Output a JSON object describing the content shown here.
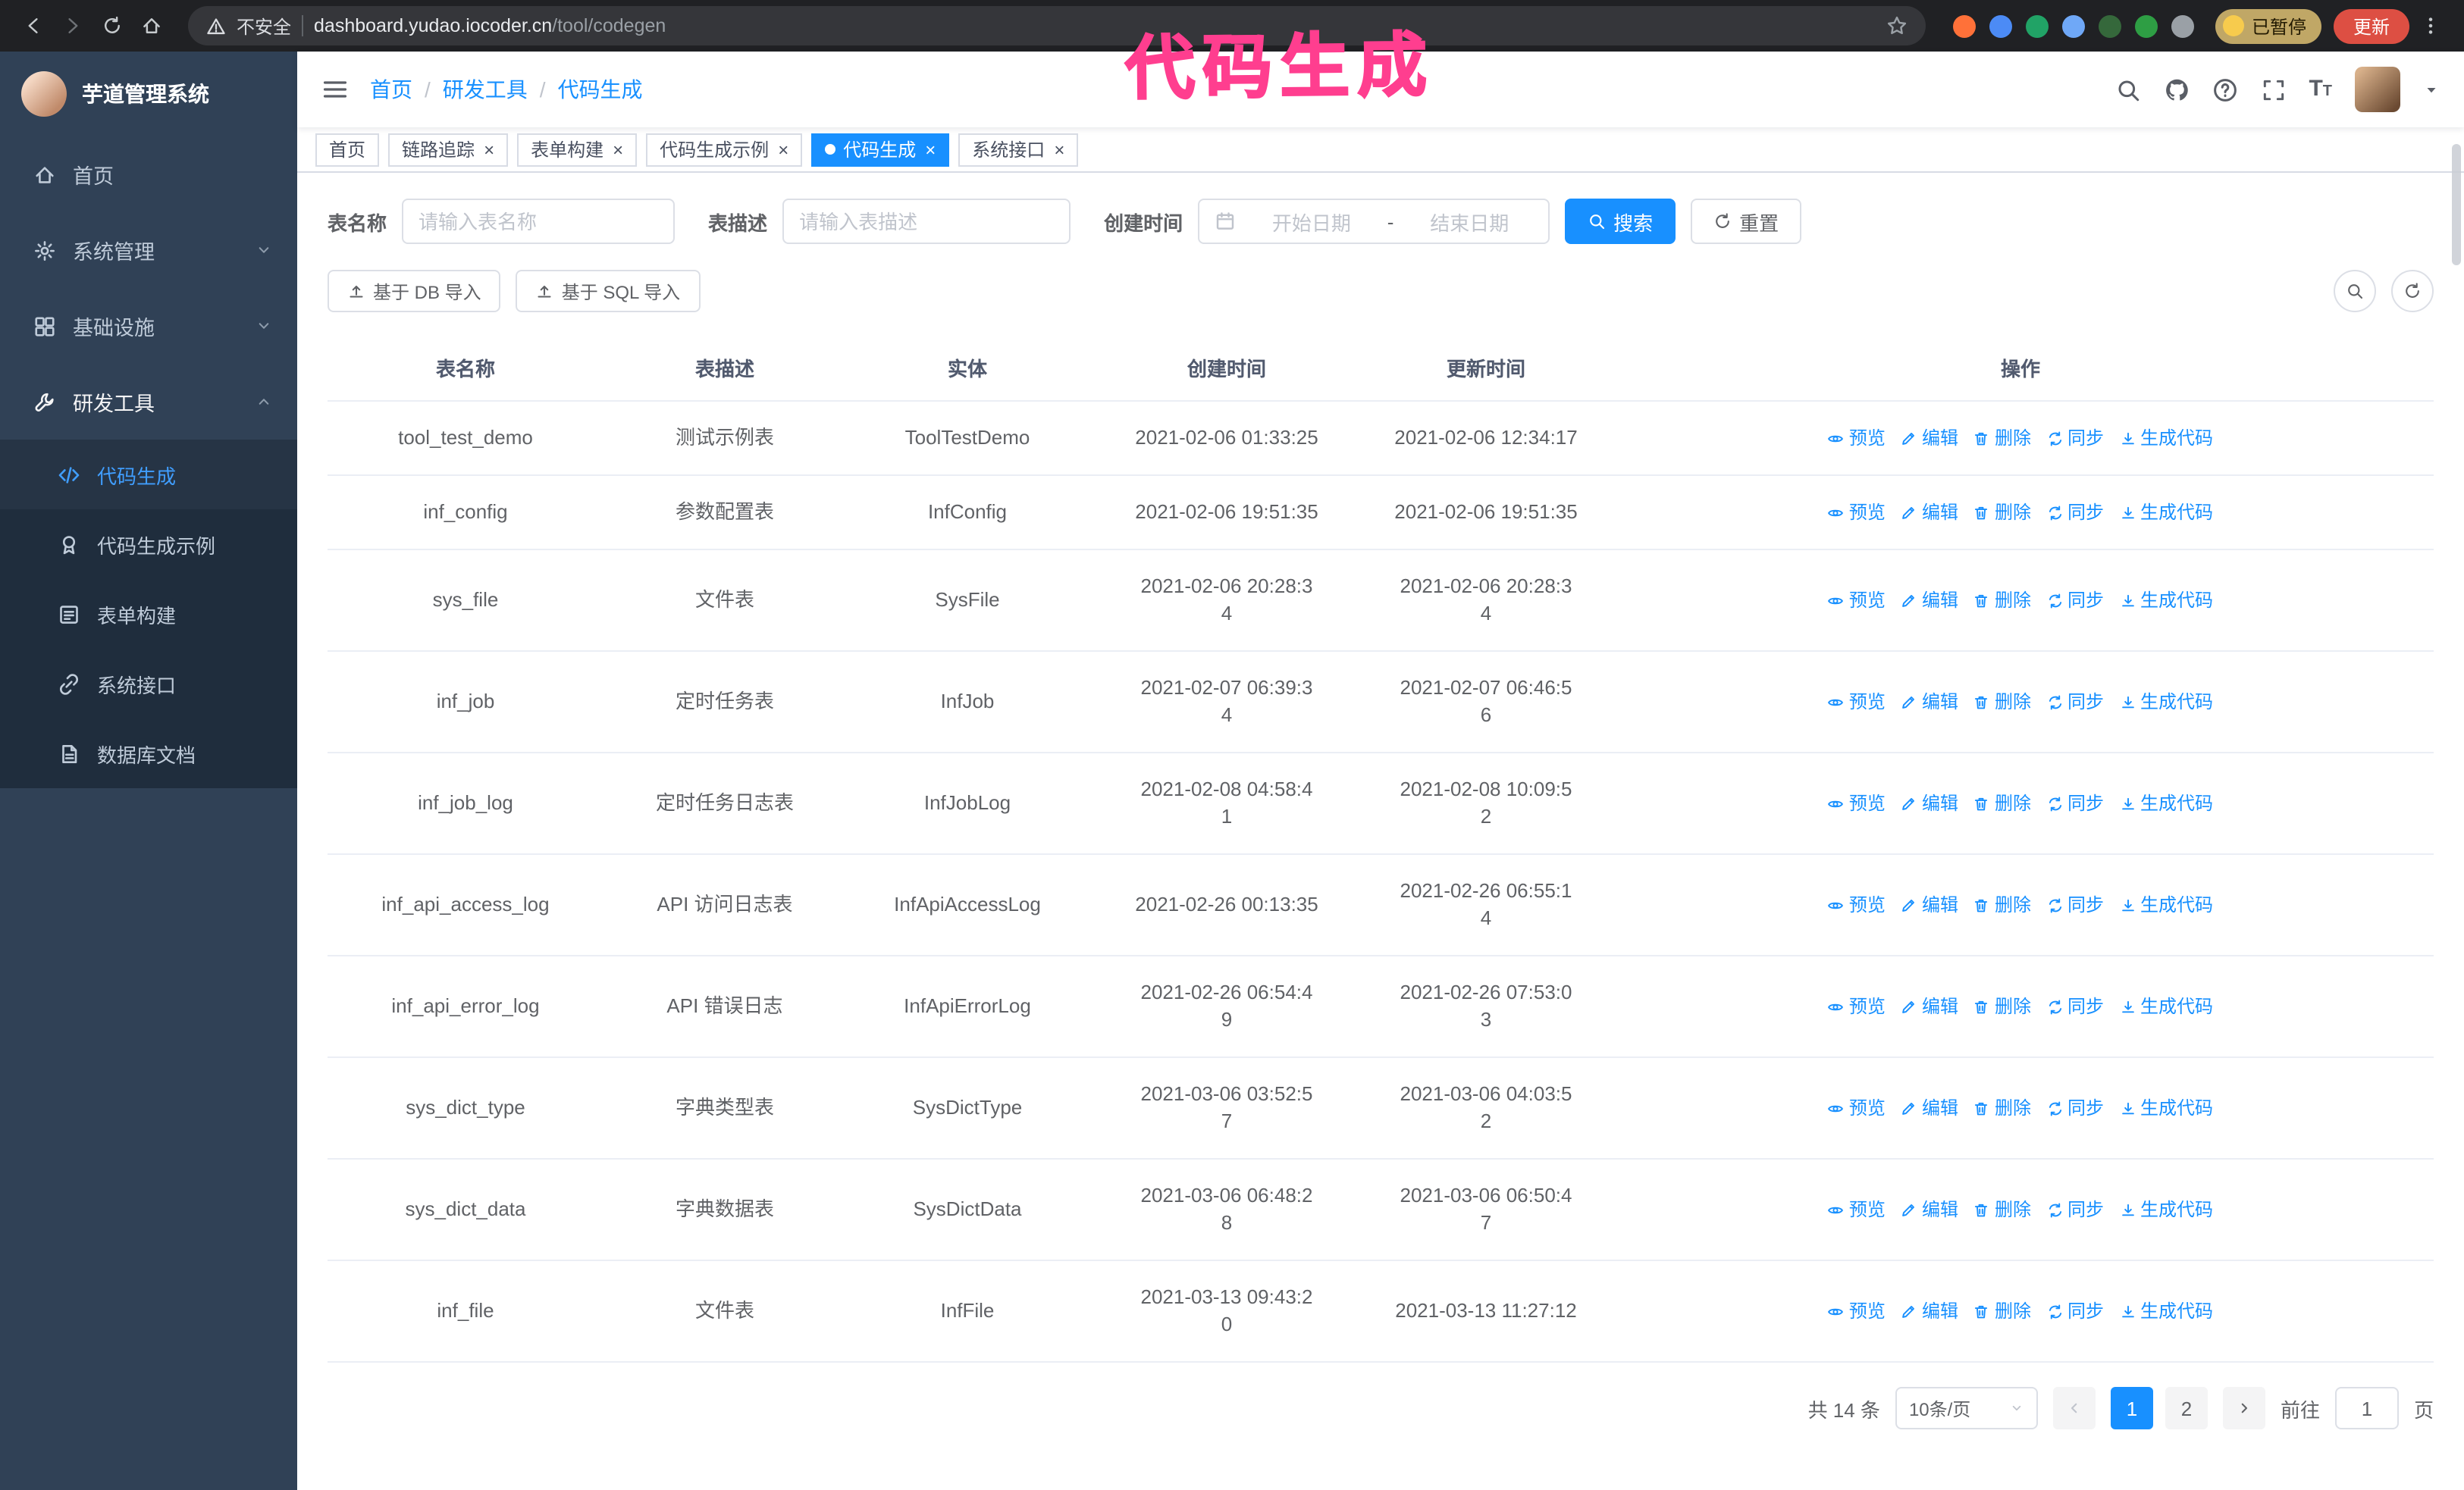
{
  "annotation": {
    "text": "代码生成",
    "color": "#ff3e8f"
  },
  "browser": {
    "security_warning": "不安全",
    "url_host": "dashboard.yudao.iocoder.cn",
    "url_path": "/tool/codegen",
    "paused_badge": "已暂停",
    "update_button": "更新",
    "extensions": [
      {
        "name": "extension-fox",
        "color": "#ff7139"
      },
      {
        "name": "extension-drop",
        "color": "#4c8bf5"
      },
      {
        "name": "extension-v-green",
        "color": "#21a366"
      },
      {
        "name": "extension-users",
        "color": "#6fa8f7"
      },
      {
        "name": "extension-shield",
        "color": "#35683b"
      },
      {
        "name": "extension-leaf",
        "color": "#2e9e44"
      },
      {
        "name": "extension-puzzle",
        "color": "#9aa0a6"
      }
    ]
  },
  "sidebar": {
    "app_title": "芋道管理系统",
    "items": [
      {
        "id": "home",
        "label": "首页",
        "icon": "home"
      },
      {
        "id": "system-manage",
        "label": "系统管理",
        "icon": "gear",
        "chevron": "down"
      },
      {
        "id": "infrastructure",
        "label": "基础设施",
        "icon": "grid",
        "chevron": "down"
      },
      {
        "id": "dev-tools",
        "label": "研发工具",
        "icon": "tool",
        "chevron": "up",
        "expanded": true,
        "children": [
          {
            "id": "codegen",
            "label": "代码生成",
            "icon": "code",
            "active": true
          },
          {
            "id": "codegen-example",
            "label": "代码生成示例",
            "icon": "badge"
          },
          {
            "id": "form-build",
            "label": "表单构建",
            "icon": "form"
          },
          {
            "id": "system-api",
            "label": "系统接口",
            "icon": "api"
          },
          {
            "id": "db-doc",
            "label": "数据库文档",
            "icon": "doc"
          }
        ]
      }
    ]
  },
  "header": {
    "breadcrumb": [
      "首页",
      "研发工具",
      "代码生成"
    ],
    "breadcrumb_separator": "/"
  },
  "tabs": [
    {
      "id": "home",
      "label": "首页",
      "closable": false,
      "active": false
    },
    {
      "id": "trace",
      "label": "链路追踪",
      "closable": true,
      "active": false
    },
    {
      "id": "form-build",
      "label": "表单构建",
      "closable": true,
      "active": false
    },
    {
      "id": "codegen-example",
      "label": "代码生成示例",
      "closable": true,
      "active": false
    },
    {
      "id": "codegen",
      "label": "代码生成",
      "closable": true,
      "active": true
    },
    {
      "id": "system-api",
      "label": "系统接口",
      "closable": true,
      "active": false
    }
  ],
  "filters": {
    "table_name_label": "表名称",
    "table_name_placeholder": "请输入表名称",
    "table_desc_label": "表描述",
    "table_desc_placeholder": "请输入表描述",
    "create_time_label": "创建时间",
    "date_start_placeholder": "开始日期",
    "date_separator": "-",
    "date_end_placeholder": "结束日期",
    "search_button": "搜索",
    "reset_button": "重置"
  },
  "toolbar": {
    "import_db": "基于 DB 导入",
    "import_sql": "基于 SQL 导入"
  },
  "table": {
    "columns": [
      "表名称",
      "表描述",
      "实体",
      "创建时间",
      "更新时间",
      "操作"
    ],
    "actions": [
      {
        "id": "preview",
        "label": "预览",
        "icon": "eye"
      },
      {
        "id": "edit",
        "label": "编辑",
        "icon": "edit"
      },
      {
        "id": "delete",
        "label": "删除",
        "icon": "trash"
      },
      {
        "id": "sync",
        "label": "同步",
        "icon": "sync"
      },
      {
        "id": "generate",
        "label": "生成代码",
        "icon": "download"
      }
    ],
    "rows": [
      {
        "name": "tool_test_demo",
        "desc": "测试示例表",
        "entity": "ToolTestDemo",
        "created": "2021-02-06 01:33:25",
        "updated": "2021-02-06 12:34:17"
      },
      {
        "name": "inf_config",
        "desc": "参数配置表",
        "entity": "InfConfig",
        "created": "2021-02-06 19:51:35",
        "updated": "2021-02-06 19:51:35"
      },
      {
        "name": "sys_file",
        "desc": "文件表",
        "entity": "SysFile",
        "created": "2021-02-06 20:28:3\n4",
        "updated": "2021-02-06 20:28:3\n4"
      },
      {
        "name": "inf_job",
        "desc": "定时任务表",
        "entity": "InfJob",
        "created": "2021-02-07 06:39:3\n4",
        "updated": "2021-02-07 06:46:5\n6"
      },
      {
        "name": "inf_job_log",
        "desc": "定时任务日志表",
        "entity": "InfJobLog",
        "created": "2021-02-08 04:58:4\n1",
        "updated": "2021-02-08 10:09:5\n2"
      },
      {
        "name": "inf_api_access_log",
        "desc": "API 访问日志表",
        "entity": "InfApiAccessLog",
        "created": "2021-02-26 00:13:35",
        "updated": "2021-02-26 06:55:1\n4"
      },
      {
        "name": "inf_api_error_log",
        "desc": "API 错误日志",
        "entity": "InfApiErrorLog",
        "created": "2021-02-26 06:54:4\n9",
        "updated": "2021-02-26 07:53:0\n3"
      },
      {
        "name": "sys_dict_type",
        "desc": "字典类型表",
        "entity": "SysDictType",
        "created": "2021-03-06 03:52:5\n7",
        "updated": "2021-03-06 04:03:5\n2"
      },
      {
        "name": "sys_dict_data",
        "desc": "字典数据表",
        "entity": "SysDictData",
        "created": "2021-03-06 06:48:2\n8",
        "updated": "2021-03-06 06:50:4\n7"
      },
      {
        "name": "inf_file",
        "desc": "文件表",
        "entity": "InfFile",
        "created": "2021-03-13 09:43:2\n0",
        "updated": "2021-03-13 11:27:12"
      }
    ]
  },
  "pagination": {
    "total": "共 14 条",
    "page_size": "10条/页",
    "pages": [
      "1",
      "2"
    ],
    "active_page": "1",
    "goto_label": "前往",
    "goto_value": "1",
    "goto_suffix": "页"
  },
  "colors": {
    "accent": "#1890ff",
    "sidebar_bg": "#304156",
    "submenu_bg": "#1f2d3d",
    "annotation": "#ff3e8f",
    "update_button": "#dd4f43"
  }
}
